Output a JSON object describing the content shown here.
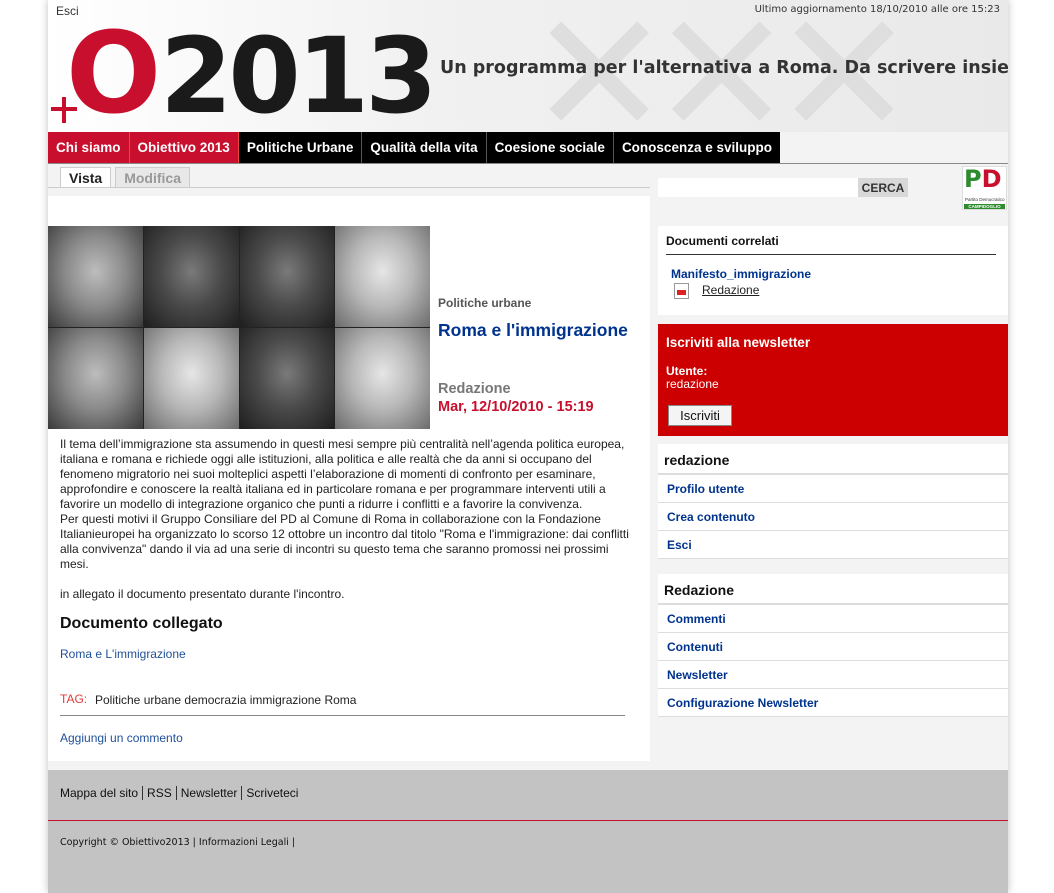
{
  "header": {
    "logout": "Esci",
    "last_update": "Ultimo aggiornamento 18/10/2010 alle ore 15:23",
    "logo_o": "O",
    "logo_year": "2013",
    "tagline": "Un programma per l'alternativa a Roma. Da scrivere insieme."
  },
  "nav": {
    "items": [
      "Chi siamo",
      "Obiettivo 2013",
      "Politiche Urbane",
      "Qualità della vita",
      "Coesione sociale",
      "Conoscenza e sviluppo"
    ]
  },
  "tabs": {
    "view": "Vista",
    "edit": "Modifica"
  },
  "article": {
    "category": "Politiche urbane",
    "title": "Roma e l'immigrazione",
    "author": "Redazione",
    "date": "Mar, 12/10/2010 - 15:19",
    "paragraph1": "Il tema dell’immigrazione sta assumendo in questi mesi sempre più centralità nell’agenda politica europea, italiana e romana e richiede oggi alle istituzioni, alla politica e alle realtà che da anni si occupano del fenomeno migratorio nei suoi molteplici aspetti l’elaborazione di momenti di confronto per esaminare, approfondire e conoscere la realtà italiana ed in particolare romana e per programmare interventi utili a favorire un modello di integrazione organico che punti a ridurre i conflitti e a favorire la convivenza.",
    "paragraph2": "Per questi motivi il Gruppo Consiliare del PD al Comune di Roma in collaborazione con la Fondazione Italianieuropei ha organizzato lo scorso 12 ottobre un incontro dal titolo \"Roma e l'immigrazione: dai conflitti alla convivenza\" dando il via ad una serie di incontri su questo tema che saranno promossi nei prossimi mesi.",
    "paragraph3": "in allegato il documento presentato durante l'incontro.",
    "doc_heading": "Documento collegato",
    "doc_link": "Roma e L'immigrazione",
    "tag_label": "TAG:",
    "tags": "Politiche urbane democrazia immigrazione Roma",
    "add_comment": "Aggiungi un commento"
  },
  "search": {
    "button": "CERCA",
    "value": ""
  },
  "pd_logo": {
    "p": "P",
    "d": "D",
    "sub": "Partito Democratico",
    "bar": "CAMPIDOGLIO"
  },
  "related": {
    "title": "Documenti correlati",
    "doc_title": "Manifesto_immigrazione",
    "doc_link": "Redazione"
  },
  "newsletter": {
    "title": "Iscriviti alla newsletter",
    "user_label": "Utente:",
    "user_value": "redazione",
    "button": "Iscriviti"
  },
  "user_menu": {
    "title": "redazione",
    "items": [
      "Profilo utente",
      "Crea contenuto",
      "Esci"
    ]
  },
  "admin_menu": {
    "title": "Redazione",
    "items": [
      "Commenti",
      "Contenuti",
      "Newsletter",
      "Configurazione Newsletter"
    ]
  },
  "footer": {
    "links": [
      "Mappa del sito",
      "RSS",
      "Newsletter",
      "Scriveteci"
    ],
    "copyright": "Copyright © Obiettivo2013 | Informazioni Legali |"
  }
}
